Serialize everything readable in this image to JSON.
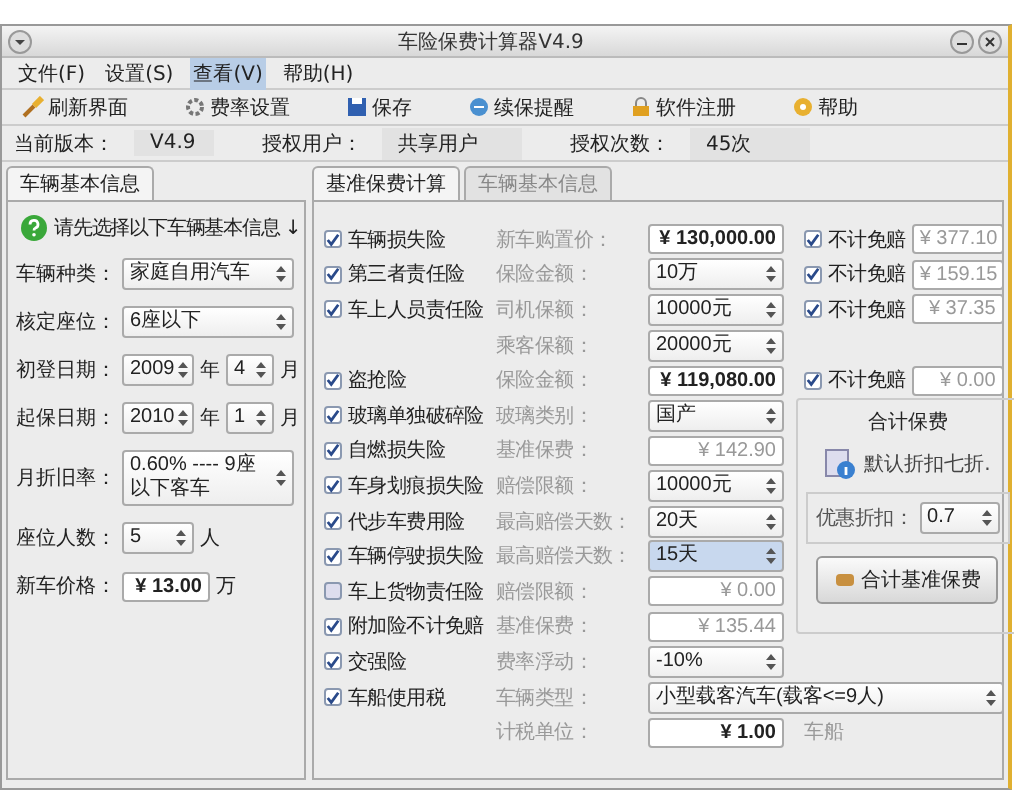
{
  "window": {
    "title": "车险保费计算器V4.9"
  },
  "menu": [
    {
      "label": "文件(F)",
      "selected": false
    },
    {
      "label": "设置(S)",
      "selected": false
    },
    {
      "label": "查看(V)",
      "selected": true
    },
    {
      "label": "帮助(H)",
      "selected": false
    }
  ],
  "toolbar": [
    {
      "label": "刷新界面"
    },
    {
      "label": "费率设置"
    },
    {
      "label": "保存"
    },
    {
      "label": "续保提醒"
    },
    {
      "label": "软件注册"
    },
    {
      "label": "帮助"
    }
  ],
  "info": [
    {
      "label": "当前版本：",
      "value": "V4.9"
    },
    {
      "label": "授权用户：",
      "value": "共享用户"
    },
    {
      "label": "授权次数：",
      "value": "45次"
    }
  ],
  "left_tab": {
    "label": "车辆基本信息",
    "selected": true
  },
  "left_panel": {
    "hint": "请先选择以下车辆基本信息 ↓",
    "fields": [
      {
        "label": "车辆种类：",
        "kind": "select",
        "value": "家庭自用汽车"
      },
      {
        "label": "核定座位：",
        "kind": "select",
        "value": "6座以下"
      },
      {
        "label": "初登日期：",
        "kind": "date",
        "year": "2009",
        "year_unit": "年",
        "month": "4",
        "month_unit": "月"
      },
      {
        "label": "起保日期：",
        "kind": "date",
        "year": "2010",
        "year_unit": "年",
        "month": "1",
        "month_unit": "月"
      },
      {
        "label": "月折旧率：",
        "kind": "select",
        "value": "0.60% ---- 9座以下客车"
      },
      {
        "label": "座位人数：",
        "kind": "spin",
        "value": "5",
        "unit": "人"
      },
      {
        "label": "新车价格：",
        "kind": "input",
        "value": "¥ 13.00",
        "unit": "万"
      }
    ]
  },
  "right_tabs": [
    {
      "label": "基准保费计算",
      "selected": true
    },
    {
      "label": "车辆基本信息",
      "selected": false
    }
  ],
  "rows": [
    {
      "name": "车辆损失险",
      "checked": true,
      "label": "新车购置价：",
      "field": {
        "kind": "input",
        "value": "¥ 130,000.00",
        "focused": false
      },
      "exempt": {
        "label": "不计免赔",
        "checked": true,
        "value": "¥ 377.10"
      }
    },
    {
      "name": "第三者责任险",
      "checked": true,
      "label": "保险金额：",
      "field": {
        "kind": "select",
        "value": "10万",
        "focused": false
      },
      "exempt": {
        "label": "不计免赔",
        "checked": true,
        "value": "¥ 159.15"
      }
    },
    {
      "name": "车上人员责任险",
      "checked": true,
      "label": "司机保额：",
      "field": {
        "kind": "select",
        "value": "10000元",
        "focused": false
      },
      "exempt": {
        "label": "不计免赔",
        "checked": true,
        "value": "¥ 37.35"
      }
    },
    {
      "label": "乘客保额：",
      "field": {
        "kind": "select",
        "value": "20000元",
        "focused": false
      }
    },
    {
      "name": "盗抢险",
      "checked": true,
      "label": "保险金额：",
      "field": {
        "kind": "input",
        "value": "¥ 119,080.00",
        "focused": false
      },
      "exempt": {
        "label": "不计免赔",
        "checked": true,
        "value": "¥ 0.00"
      }
    },
    {
      "name": "玻璃单独破碎险",
      "checked": true,
      "label": "玻璃类别：",
      "field": {
        "kind": "select",
        "value": "国产",
        "focused": false
      }
    },
    {
      "name": "自燃损失险",
      "checked": true,
      "label": "基准保费：",
      "field": {
        "kind": "readonly",
        "value": "¥ 142.90",
        "focused": false
      }
    },
    {
      "name": "车身划痕损失险",
      "checked": true,
      "label": "赔偿限额：",
      "field": {
        "kind": "select",
        "value": "10000元",
        "focused": false
      }
    },
    {
      "name": "代步车费用险",
      "checked": true,
      "label": "最高赔偿天数：",
      "field": {
        "kind": "select",
        "value": "20天",
        "focused": false
      }
    },
    {
      "name": "车辆停驶损失险",
      "checked": true,
      "label": "最高赔偿天数：",
      "field": {
        "kind": "select",
        "value": "15天",
        "focused": true
      }
    },
    {
      "name": "车上货物责任险",
      "checked": false,
      "label": "赔偿限额：",
      "field": {
        "kind": "readonly",
        "value": "¥ 0.00",
        "focused": false
      }
    },
    {
      "name": "附加险不计免赔",
      "checked": true,
      "label": "基准保费：",
      "field": {
        "kind": "readonly",
        "value": "¥ 135.44",
        "focused": false
      }
    },
    {
      "name": "交强险",
      "checked": true,
      "label": "费率浮动：",
      "field": {
        "kind": "select",
        "value": "-10%",
        "focused": false
      }
    },
    {
      "name": "车船使用税",
      "checked": true,
      "label": "车辆类型：",
      "field": {
        "kind": "wide_select",
        "value": "小型载客汽车(载客<=9人)",
        "focused": false
      }
    },
    {
      "label": "计税单位：",
      "field": {
        "kind": "input",
        "value": "¥ 1.00",
        "focused": false
      },
      "extra": "车船"
    }
  ],
  "summary": {
    "title": "合计保费",
    "note": "默认折扣七折.",
    "discount_label": "优惠折扣：",
    "discount": "0.7",
    "button": "合计基准保费"
  }
}
